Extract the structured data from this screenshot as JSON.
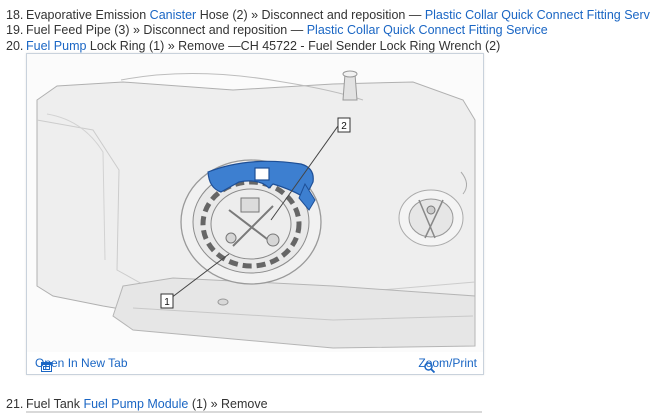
{
  "steps": [
    {
      "num": "18.",
      "pre": "Evaporative Emission ",
      "link1": "Canister",
      "mid": " Hose (2) » Disconnect and reposition — ",
      "link2": "Plastic Collar Quick Connect Fitting Service"
    },
    {
      "num": "19.",
      "pre": "Fuel Feed Pipe (3) » Disconnect and reposition — ",
      "link2": "Plastic Collar Quick Connect Fitting Service"
    },
    {
      "num": "20.",
      "link1": "Fuel Pump",
      "mid": " Lock Ring (1) » Remove —CH 45722 - Fuel Sender Lock Ring Wrench (2)"
    },
    {
      "num": "21.",
      "pre": "Fuel Tank ",
      "link1": "Fuel Pump Module",
      "mid": " (1) » Remove"
    }
  ],
  "figure": {
    "callouts": [
      "1",
      "2"
    ],
    "toolbar": {
      "open_tab_label": "Open In New Tab",
      "open_tab_icon": "open-new-tab-icon",
      "zoom_label": "Zoom/Print",
      "zoom_icon": "magnifier-icon"
    },
    "colors": {
      "wrench": "#3d7fd0",
      "link": "#1a66c4"
    }
  }
}
